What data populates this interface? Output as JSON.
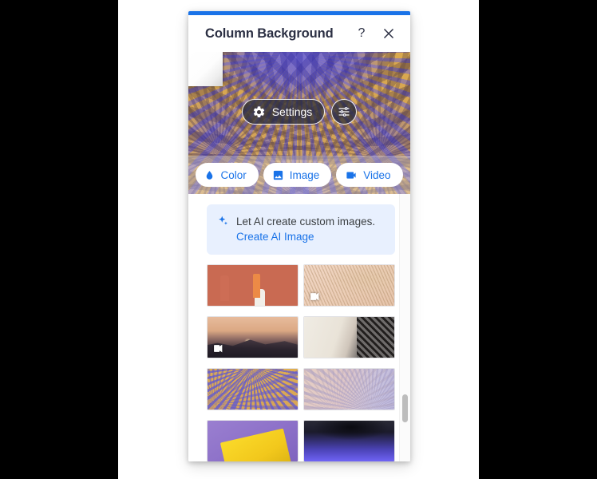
{
  "window": {
    "accent_color": "#1a73e8",
    "title": "Column Background",
    "help_icon": "question-mark-icon",
    "close_icon": "close-icon"
  },
  "hero": {
    "corner_swatch": "page-curl-swatch",
    "settings_button": {
      "label": "Settings",
      "icon": "gear-icon"
    },
    "tune_button": {
      "icon": "sliders-icon"
    },
    "tabs": [
      {
        "label": "Color",
        "icon": "water-drop-icon"
      },
      {
        "label": "Image",
        "icon": "picture-icon"
      },
      {
        "label": "Video",
        "icon": "video-camera-icon"
      }
    ]
  },
  "ai_banner": {
    "icon": "sparkle-icon",
    "text": "Let AI create custom images.",
    "link_label": "Create AI Image",
    "background_color": "#e8f0fe",
    "link_color": "#1a73e8"
  },
  "thumbnails": [
    {
      "name": "thumbnail-painters",
      "art": "art-painters",
      "is_video": false
    },
    {
      "name": "thumbnail-flowing-fabric",
      "art": "art-flow",
      "is_video": true
    },
    {
      "name": "thumbnail-mountain-sunset",
      "art": "art-mountain",
      "is_video": true
    },
    {
      "name": "thumbnail-father-and-son",
      "art": "art-kids",
      "is_video": false
    },
    {
      "name": "thumbnail-palm-duotone",
      "art": "art-palm",
      "is_video": false
    },
    {
      "name": "thumbnail-pastel-fronds",
      "art": "art-fronds",
      "is_video": false
    },
    {
      "name": "thumbnail-yellow-bag",
      "art": "art-yellowbag",
      "is_video": false
    },
    {
      "name": "thumbnail-blue-blur",
      "art": "art-blur",
      "is_video": false
    }
  ],
  "scrollbar": {
    "thumb_position_percent": 75
  }
}
